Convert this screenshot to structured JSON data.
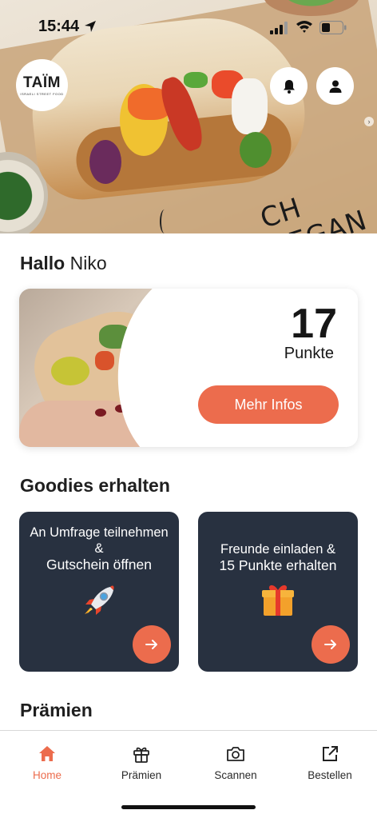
{
  "status_bar": {
    "time": "15:44"
  },
  "brand": {
    "logo_text": "TAÏM",
    "logo_subtext": "ISRAELI STREET FOOD"
  },
  "hero": {
    "image": "falafel-pita-photo",
    "overlay_text": "CH VEGAN"
  },
  "greeting": {
    "prefix": "Hallo",
    "name": "Niko"
  },
  "points": {
    "value": "17",
    "unit": "Punkte",
    "button_label": "Mehr Infos"
  },
  "goodies": {
    "title": "Goodies erhalten",
    "cards": [
      {
        "line1": "An Umfrage teilnehmen",
        "line2": "&",
        "line3": "Gutschein öffnen",
        "icon": "rocket-icon"
      },
      {
        "line1": "Freunde einladen &",
        "line2": "15 Punkte erhalten",
        "icon": "gift-icon"
      }
    ]
  },
  "rewards": {
    "title": "Prämien"
  },
  "tabs": [
    {
      "label": "Home",
      "icon": "home-icon",
      "active": true
    },
    {
      "label": "Prämien",
      "icon": "gift-icon"
    },
    {
      "label": "Scannen",
      "icon": "camera-icon"
    },
    {
      "label": "Bestellen",
      "icon": "external-link-icon"
    }
  ],
  "colors": {
    "accent": "#ec6c4d",
    "card_dark": "#283140"
  }
}
